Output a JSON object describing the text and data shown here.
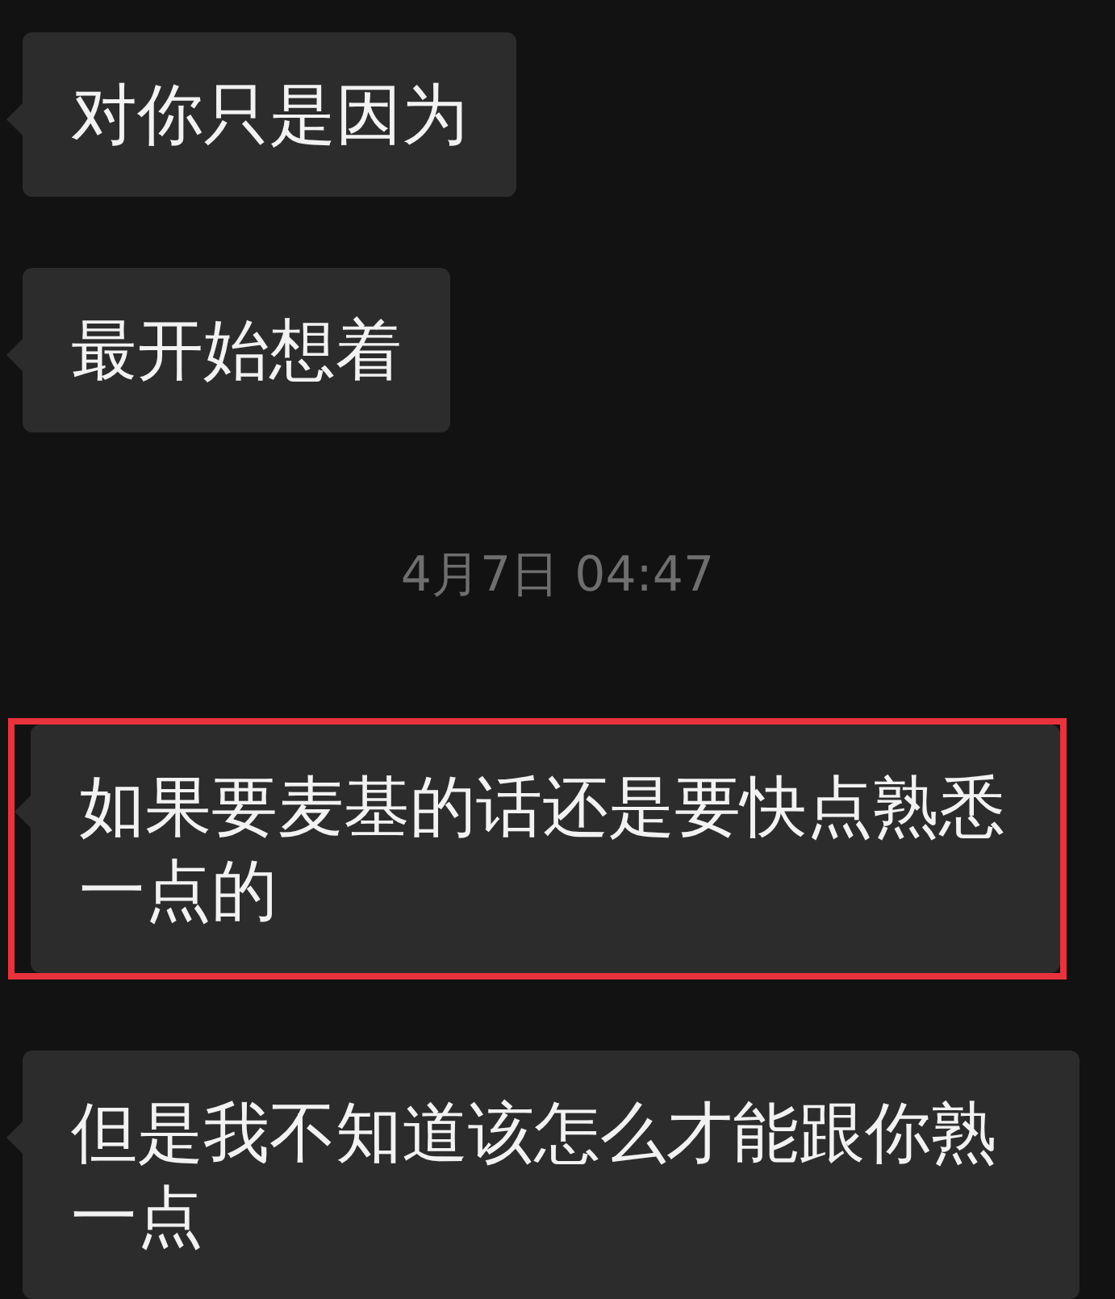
{
  "messages": [
    {
      "kind": "bubble",
      "text": "对你只是因为",
      "highlighted": false
    },
    {
      "kind": "bubble",
      "text": "最开始想着",
      "highlighted": false
    },
    {
      "kind": "timestamp",
      "text": "4月7日 04:47"
    },
    {
      "kind": "bubble",
      "text": "如果要麦基的话还是要快点熟悉一点的",
      "highlighted": true
    },
    {
      "kind": "bubble",
      "text": "但是我不知道该怎么才能跟你熟一点",
      "highlighted": false
    }
  ]
}
